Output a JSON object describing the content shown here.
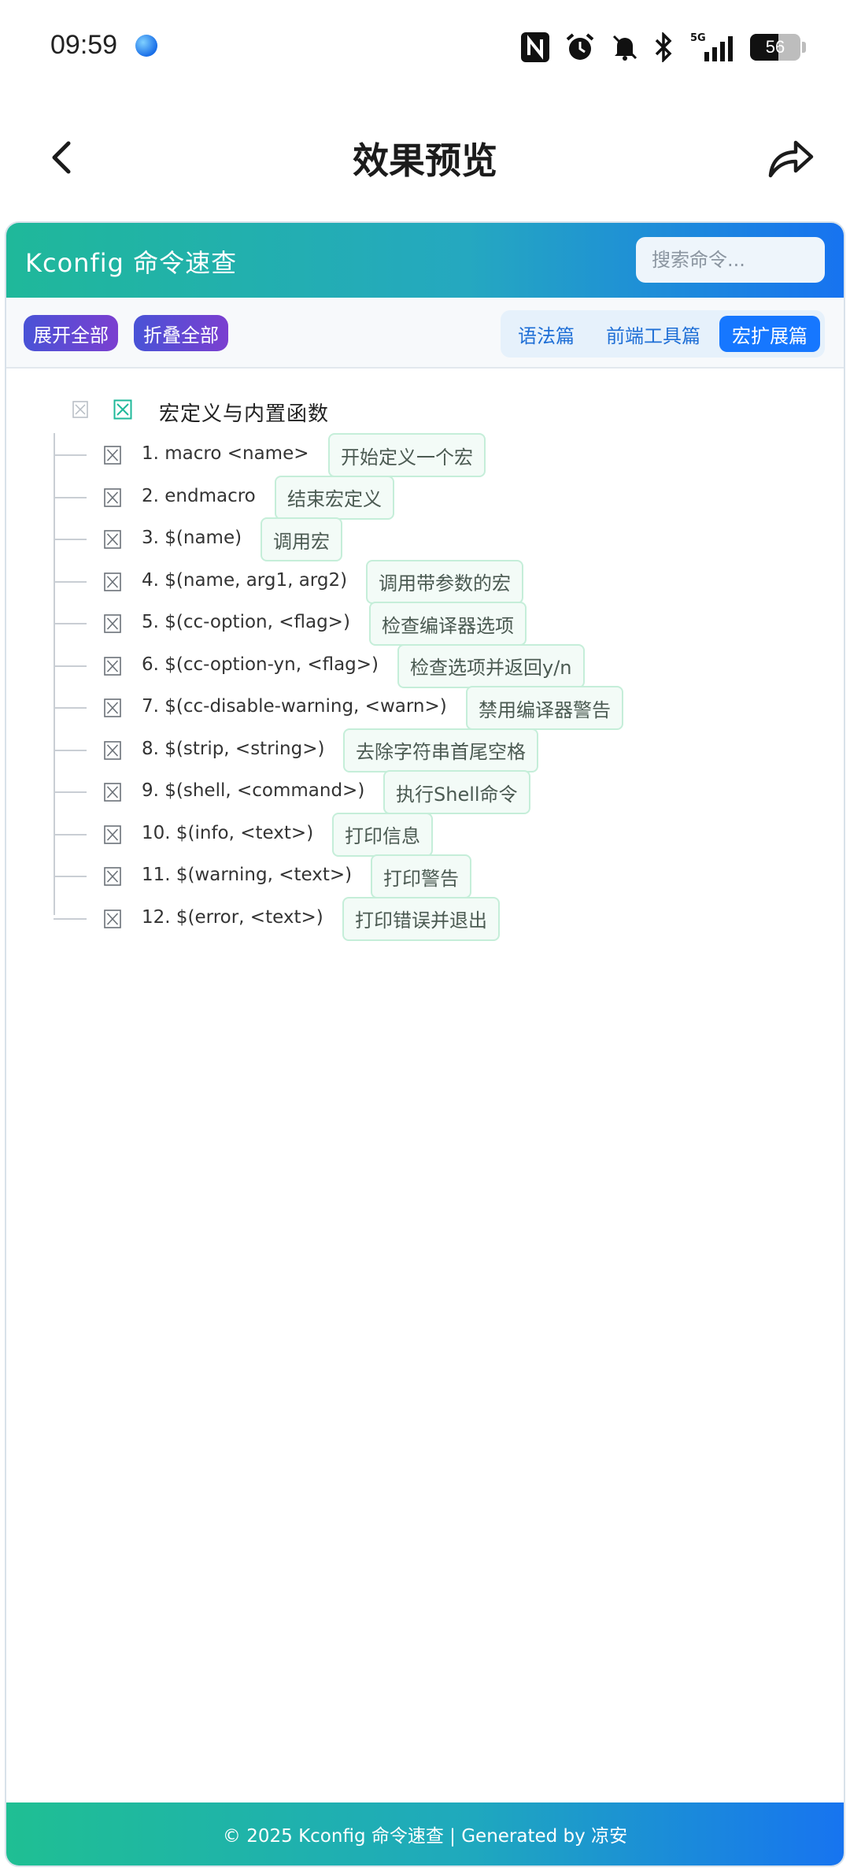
{
  "status_bar": {
    "time": "09:59",
    "network": "5G",
    "battery_level": 56,
    "battery_text": "56",
    "icons": [
      "nfc-icon",
      "alarm-icon",
      "mute-icon",
      "bluetooth-icon",
      "signal-icon",
      "battery-icon"
    ]
  },
  "nav": {
    "title": "效果预览",
    "back_icon": "chevron-left-icon",
    "share_icon": "share-icon"
  },
  "app": {
    "title": "Kconfig 命令速查",
    "search": {
      "placeholder": "搜索命令...",
      "value": ""
    },
    "toolbar": {
      "expand_all": "展开全部",
      "collapse_all": "折叠全部"
    },
    "tabs": [
      {
        "label": "语法篇",
        "active": false
      },
      {
        "label": "前端工具篇",
        "active": false
      },
      {
        "label": "宏扩展篇",
        "active": true
      }
    ],
    "tree": {
      "root_label": "宏定义与内置函数",
      "items": [
        {
          "cmd": "1. macro <name>",
          "desc": "开始定义一个宏"
        },
        {
          "cmd": "2. endmacro",
          "desc": "结束宏定义"
        },
        {
          "cmd": "3. $(name)",
          "desc": "调用宏"
        },
        {
          "cmd": "4. $(name, arg1, arg2)",
          "desc": "调用带参数的宏"
        },
        {
          "cmd": "5. $(cc-option, <flag>)",
          "desc": "检查编译器选项"
        },
        {
          "cmd": "6. $(cc-option-yn, <flag>)",
          "desc": "检查选项并返回y/n"
        },
        {
          "cmd": "7. $(cc-disable-warning, <warn>)",
          "desc": "禁用编译器警告"
        },
        {
          "cmd": "8. $(strip, <string>)",
          "desc": "去除字符串首尾空格"
        },
        {
          "cmd": "9. $(shell, <command>)",
          "desc": "执行Shell命令"
        },
        {
          "cmd": "10. $(info, <text>)",
          "desc": "打印信息"
        },
        {
          "cmd": "11. $(warning, <text>)",
          "desc": "打印警告"
        },
        {
          "cmd": "12. $(error, <text>)",
          "desc": "打印错误并退出"
        }
      ]
    },
    "footer": "© 2025 Kconfig 命令速查 | Generated by 凉安"
  },
  "colors": {
    "header_gradient_start": "#1fb89a",
    "header_gradient_end": "#1773f0",
    "button_gradient_start": "#4953d6",
    "button_gradient_end": "#7b3fd0",
    "tab_active": "#1677ff",
    "desc_border": "#c5eed9",
    "desc_bg": "#f3fbf7"
  }
}
